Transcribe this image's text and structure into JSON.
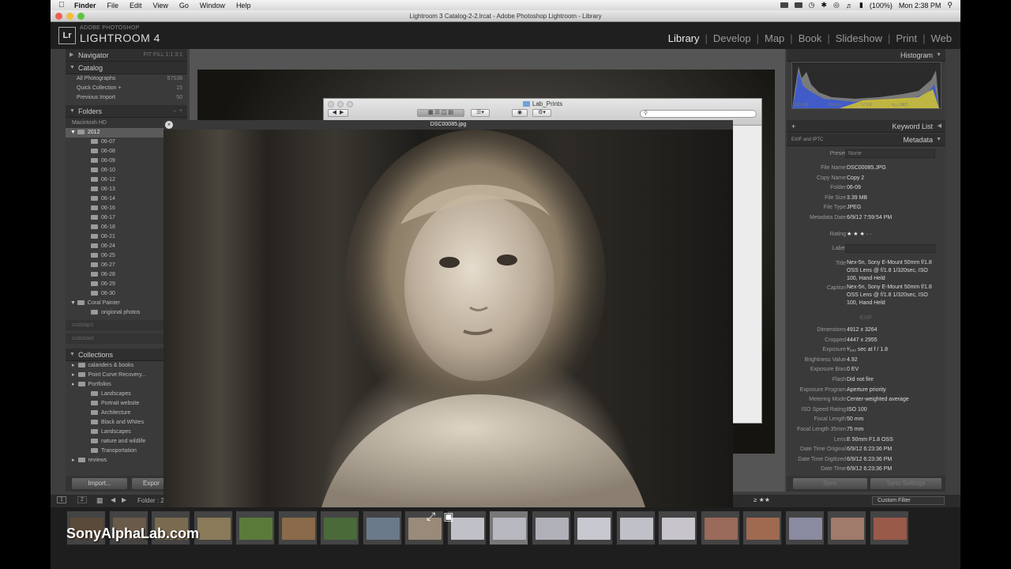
{
  "menubar": {
    "items": [
      "Finder",
      "File",
      "Edit",
      "View",
      "Go",
      "Window",
      "Help"
    ],
    "battery": "(100%)",
    "clock": "Mon 2:38 PM"
  },
  "window": {
    "title": "Lightroom 3 Catalog-2-2.lrcat - Adobe Photoshop Lightroom - Library"
  },
  "identity": {
    "logo": "Lr",
    "brand_small": "ADOBE PHOTOSHOP",
    "brand_big": "LIGHTROOM 4",
    "modules": [
      "Library",
      "Develop",
      "Map",
      "Book",
      "Slideshow",
      "Print",
      "Web"
    ],
    "active_module": "Library"
  },
  "left": {
    "navigator": {
      "title": "Navigator",
      "zoom_options": "FIT  FILL  1:1  3:1"
    },
    "catalog": {
      "title": "Catalog",
      "items": [
        {
          "label": "All Photographs",
          "count": "57538"
        },
        {
          "label": "Quick Collection +",
          "count": "15"
        },
        {
          "label": "Previous Import",
          "count": "50"
        }
      ]
    },
    "folders": {
      "title": "Folders",
      "volume": "Macintosh HD",
      "volume_info": "56.8 / 4",
      "year": "2012",
      "subfolders": [
        "06-07",
        "06-08",
        "06-09",
        "06-10",
        "06-12",
        "06-13",
        "06-14",
        "06-16",
        "06-17",
        "06-18",
        "06-21",
        "06-24",
        "06-25",
        "06-27",
        "06-28",
        "06-29",
        "06-30"
      ],
      "selected": "2012",
      "other": [
        {
          "label": "Coral Painter",
          "level": 1
        },
        {
          "label": "origional photos",
          "level": 2
        }
      ],
      "drives": [
        "ssdslap1",
        "ssdsbast"
      ]
    },
    "collections": {
      "title": "Collections",
      "items": [
        {
          "label": "calanders & books",
          "level": 0
        },
        {
          "label": "Point Curve Recovery...",
          "level": 0
        },
        {
          "label": "Portfolios",
          "level": 0
        },
        {
          "label": "Landscapes",
          "level": 1
        },
        {
          "label": "Portrait website",
          "level": 1
        },
        {
          "label": "Architecture",
          "level": 1
        },
        {
          "label": "Black and Whites",
          "level": 1
        },
        {
          "label": "Landscapes",
          "level": 1
        },
        {
          "label": "nature and wildlife",
          "level": 1
        },
        {
          "label": "Transportation",
          "level": 1
        },
        {
          "label": "reviews",
          "level": 0
        }
      ]
    },
    "import_label": "Import...",
    "export_label": "Expor"
  },
  "finder": {
    "title": "Lab_Prints",
    "search_placeholder": ""
  },
  "quicklook": {
    "title": "DSC00085.jpg"
  },
  "right": {
    "histogram_title": "Histogram",
    "histo_iso": "ISO 100",
    "histo_focal": "50 mm",
    "histo_aperture": "f / 1.8",
    "histo_shutter": "¹⁄₃₂₀ SEC",
    "keyword_list": "Keyword List",
    "metadata_title": "Metadata",
    "metadata_set": "EXIF and IPTC",
    "preset_label": "Preset",
    "preset_value": "None",
    "fields": [
      {
        "label": "File Name",
        "value": "DSC00085.JPG"
      },
      {
        "label": "Copy Name",
        "value": "Copy 2"
      },
      {
        "label": "Folder",
        "value": "06-09"
      },
      {
        "label": "File Size",
        "value": "3.39 MB"
      },
      {
        "label": "File Type",
        "value": "JPEG"
      },
      {
        "label": "Metadata Date",
        "value": "6/9/12 7:59:54 PM"
      }
    ],
    "rating_label": "Rating",
    "rating_stars": "★ ★ ★ · ·",
    "label_label": "Label",
    "title_label": "Title",
    "title_value": "Nex-5n, Sony E-Mount 50mm f/1.8 OSS Lens @ f/1.8 1/320sec, ISO 100, Hand Held",
    "caption_label": "Caption",
    "caption_value": "Nex-5n, Sony E-Mount 50mm f/1.8 OSS Lens @ f/1.8 1/320sec, ISO 100, Hand Held",
    "exif_header": "EXIF",
    "exif": [
      {
        "label": "Dimensions",
        "value": "4912 x 3264"
      },
      {
        "label": "Cropped",
        "value": "4447 x 2955"
      },
      {
        "label": "Exposure",
        "value": "¹⁄₃₂₀ sec at f / 1.8"
      },
      {
        "label": "Brightness Value",
        "value": "4.92"
      },
      {
        "label": "Exposure Bias",
        "value": "0 EV"
      },
      {
        "label": "Flash",
        "value": "Did not fire"
      },
      {
        "label": "Exposure Program",
        "value": "Aperture priority"
      },
      {
        "label": "Metering Mode",
        "value": "Center-weighted average"
      },
      {
        "label": "ISO Speed Rating",
        "value": "ISO 100"
      },
      {
        "label": "Focal Length",
        "value": "50 mm"
      },
      {
        "label": "Focal Length 35mm",
        "value": "75 mm"
      },
      {
        "label": "Lens",
        "value": "E 50mm F1.8 OSS"
      },
      {
        "label": "Date Time Original",
        "value": "6/9/12 6:23:36 PM"
      },
      {
        "label": "Date Time Digitized",
        "value": "6/9/12 6:23:36 PM"
      },
      {
        "label": "Date Time",
        "value": "6/9/12 6:23:36 PM"
      }
    ],
    "sync_label": "Sync",
    "sync_settings_label": "Sync Settings"
  },
  "filmstrip": {
    "page1": "1",
    "page2": "2",
    "source": "Folder : 2",
    "filter_label": "Custom Filter",
    "filter_stars": "≥ ★★",
    "watermark": "SonyAlphaLab.com"
  },
  "colors": {
    "accent": "#eeeeee",
    "panel": "#3a3a3a",
    "background": "#000000"
  }
}
